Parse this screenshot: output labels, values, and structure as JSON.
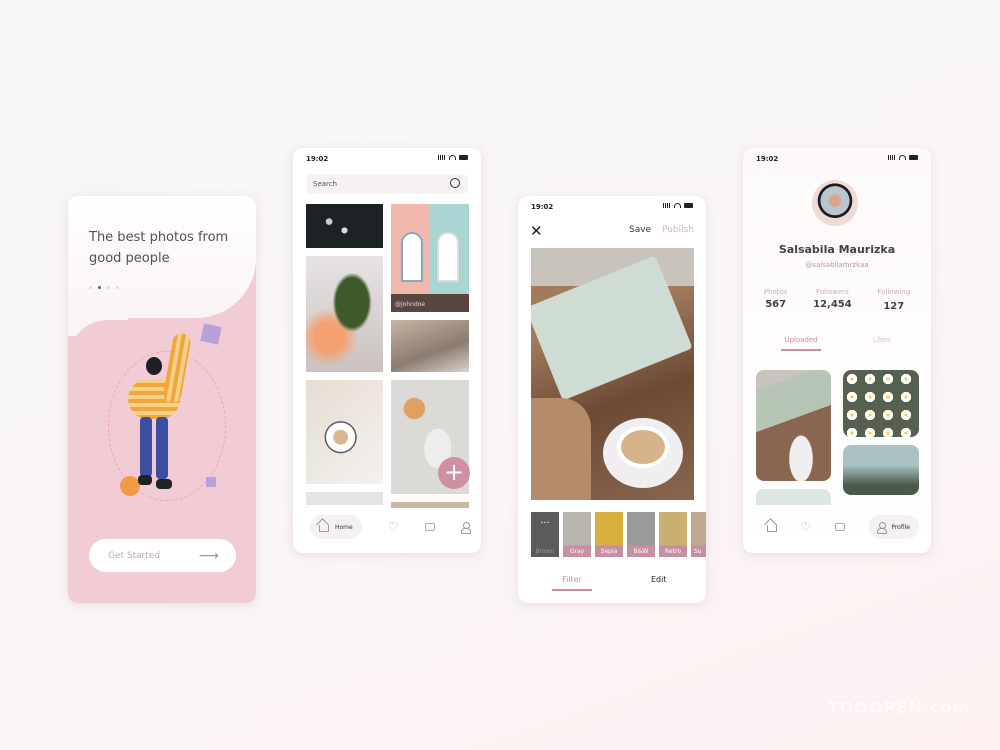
{
  "status_time": "19:02",
  "onboarding": {
    "title_line1": "The best photos from",
    "title_line2": "good people",
    "dots": 4,
    "active_dot": 2,
    "cta_label": "Get Started",
    "arrow_icon": "arrow-right-icon"
  },
  "home": {
    "search_placeholder": "Search",
    "photo_credit": "@johndoe",
    "fab_icon": "plus-icon",
    "nav": {
      "home": "Home"
    }
  },
  "editor": {
    "save": "Save",
    "publish": "Publish",
    "filters": [
      "Brown",
      "Gray",
      "Sepia",
      "B&W",
      "Retro",
      "Su"
    ],
    "tabs": {
      "filter": "Filter",
      "edit": "Edit"
    }
  },
  "profile": {
    "name": "Salsabila Maurizka",
    "handle": "@salsabilamrzkaa",
    "stats": [
      {
        "label": "Photos",
        "value": "567"
      },
      {
        "label": "Followers",
        "value": "12,454"
      },
      {
        "label": "Following",
        "value": "127"
      }
    ],
    "tabs": {
      "uploaded": "Uploaded",
      "likes": "Likes"
    },
    "nav": {
      "profile": "Profile"
    }
  },
  "colors": {
    "accent": "#c98fa2",
    "pink_bg": "#f2c9d2",
    "muted": "#d8b2bf"
  },
  "watermark": "TOOOPEN.com"
}
